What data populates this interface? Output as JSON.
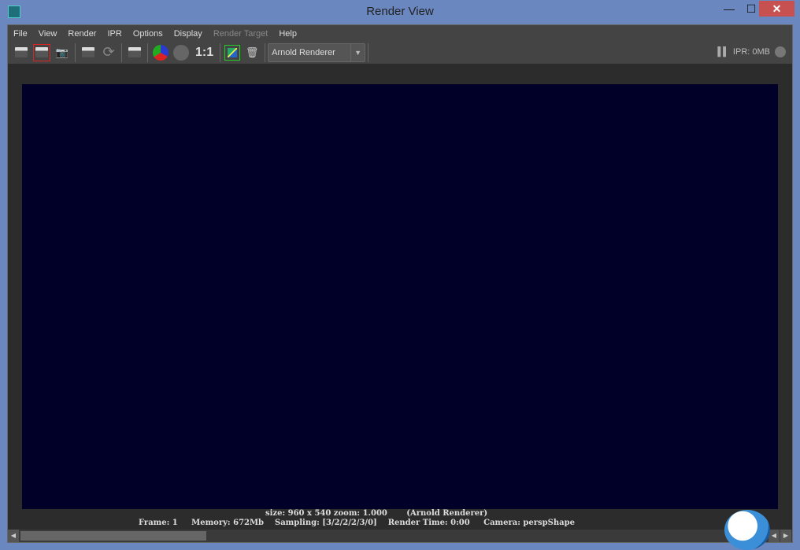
{
  "window": {
    "title": "Render View",
    "minimize": "—",
    "maximize": "☐",
    "close": "✕"
  },
  "menu": [
    "File",
    "View",
    "Render",
    "IPR",
    "Options",
    "Display",
    "Render Target",
    "Help"
  ],
  "toolbar": {
    "ratio_label": "1:1",
    "renderer": "Arnold Renderer",
    "ipr_memory": "IPR: 0MB"
  },
  "status": {
    "line1": "size: 960 x 540 zoom: 1.000       (Arnold Renderer)",
    "frame": "Frame: 1",
    "memory": "Memory: 672Mb",
    "sampling": "Sampling: [3/2/2/2/3/0]",
    "render_time": "Render Time: 0:00",
    "camera": "Camera: perspShape"
  },
  "colors": {
    "image_bg": "#000028",
    "frame": "#6b87c0"
  }
}
